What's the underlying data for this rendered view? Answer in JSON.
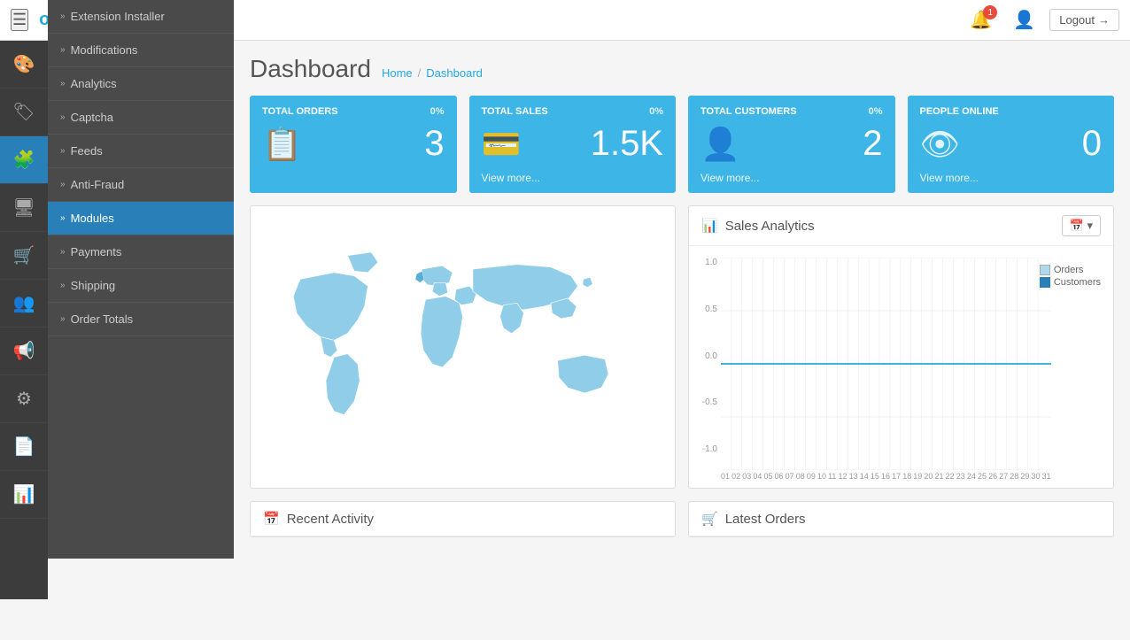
{
  "header": {
    "logo_text": "opencart",
    "hamburger_icon": "☰",
    "bell_icon": "🔔",
    "bell_badge": "1",
    "user_icon": "👤",
    "logout_label": "Logout",
    "logout_icon": "→"
  },
  "sidebar": {
    "items": [
      {
        "id": "dashboard",
        "icon": "🎨",
        "label": "Dashboard"
      },
      {
        "id": "catalog",
        "icon": "🏷",
        "label": "Catalog"
      },
      {
        "id": "extensions",
        "icon": "🧩",
        "label": "Extensions",
        "active": true
      },
      {
        "id": "design",
        "icon": "🖥",
        "label": "Design"
      },
      {
        "id": "sales",
        "icon": "🛒",
        "label": "Sales"
      },
      {
        "id": "customers",
        "icon": "👥",
        "label": "Customers"
      },
      {
        "id": "marketing",
        "icon": "📢",
        "label": "Marketing"
      },
      {
        "id": "system",
        "icon": "⚙",
        "label": "System"
      },
      {
        "id": "reports",
        "icon": "📄",
        "label": "Reports"
      },
      {
        "id": "analytics",
        "icon": "📊",
        "label": "Analytics"
      }
    ]
  },
  "dropdown": {
    "items": [
      {
        "label": "Extension Installer",
        "active": false
      },
      {
        "label": "Modifications",
        "active": false
      },
      {
        "label": "Analytics",
        "active": false
      },
      {
        "label": "Captcha",
        "active": false
      },
      {
        "label": "Feeds",
        "active": false
      },
      {
        "label": "Anti-Fraud",
        "active": false
      },
      {
        "label": "Modules",
        "active": true
      },
      {
        "label": "Payments",
        "active": false
      },
      {
        "label": "Shipping",
        "active": false
      },
      {
        "label": "Order Totals",
        "active": false
      }
    ]
  },
  "page": {
    "title": "Dashboard",
    "breadcrumb": {
      "home": "Home",
      "separator": "/",
      "current": "Dashboard"
    }
  },
  "stat_cards": [
    {
      "id": "total-orders",
      "label": "TOTAL ORDERS",
      "percent": "0%",
      "value": "3",
      "icon": "📋",
      "show_view_more": false
    },
    {
      "id": "total-sales",
      "label": "TOTAL SALES",
      "percent": "0%",
      "value": "1.5K",
      "icon": "💳",
      "view_more": "View more...",
      "show_view_more": true
    },
    {
      "id": "total-customers",
      "label": "TOTAL CUSTOMERS",
      "percent": "0%",
      "value": "2",
      "icon": "👤",
      "view_more": "View more...",
      "show_view_more": true
    },
    {
      "id": "people-online",
      "label": "PEOPLE ONLINE",
      "percent": "",
      "value": "0",
      "icon": "👁",
      "view_more": "View more...",
      "show_view_more": true
    }
  ],
  "analytics": {
    "title": "Sales Analytics",
    "title_icon": "📊",
    "calendar_icon": "📅",
    "legend": [
      {
        "label": "Orders",
        "color": "#add8f0"
      },
      {
        "label": "Customers",
        "color": "#2980b9"
      }
    ],
    "y_labels": [
      "1.0",
      "0.5",
      "0.0",
      "-0.5",
      "-1.0"
    ],
    "x_labels": [
      "01",
      "02",
      "03",
      "04",
      "05",
      "06",
      "07",
      "08",
      "09",
      "10",
      "11",
      "12",
      "13",
      "14",
      "15",
      "16",
      "17",
      "18",
      "19",
      "20",
      "21",
      "22",
      "23",
      "24",
      "25",
      "26",
      "27",
      "28",
      "29",
      "30",
      "31"
    ]
  },
  "panels": {
    "recent_activity": {
      "title": "Recent Activity",
      "icon": "📅"
    },
    "latest_orders": {
      "title": "Latest Orders",
      "icon": "🛒"
    }
  }
}
